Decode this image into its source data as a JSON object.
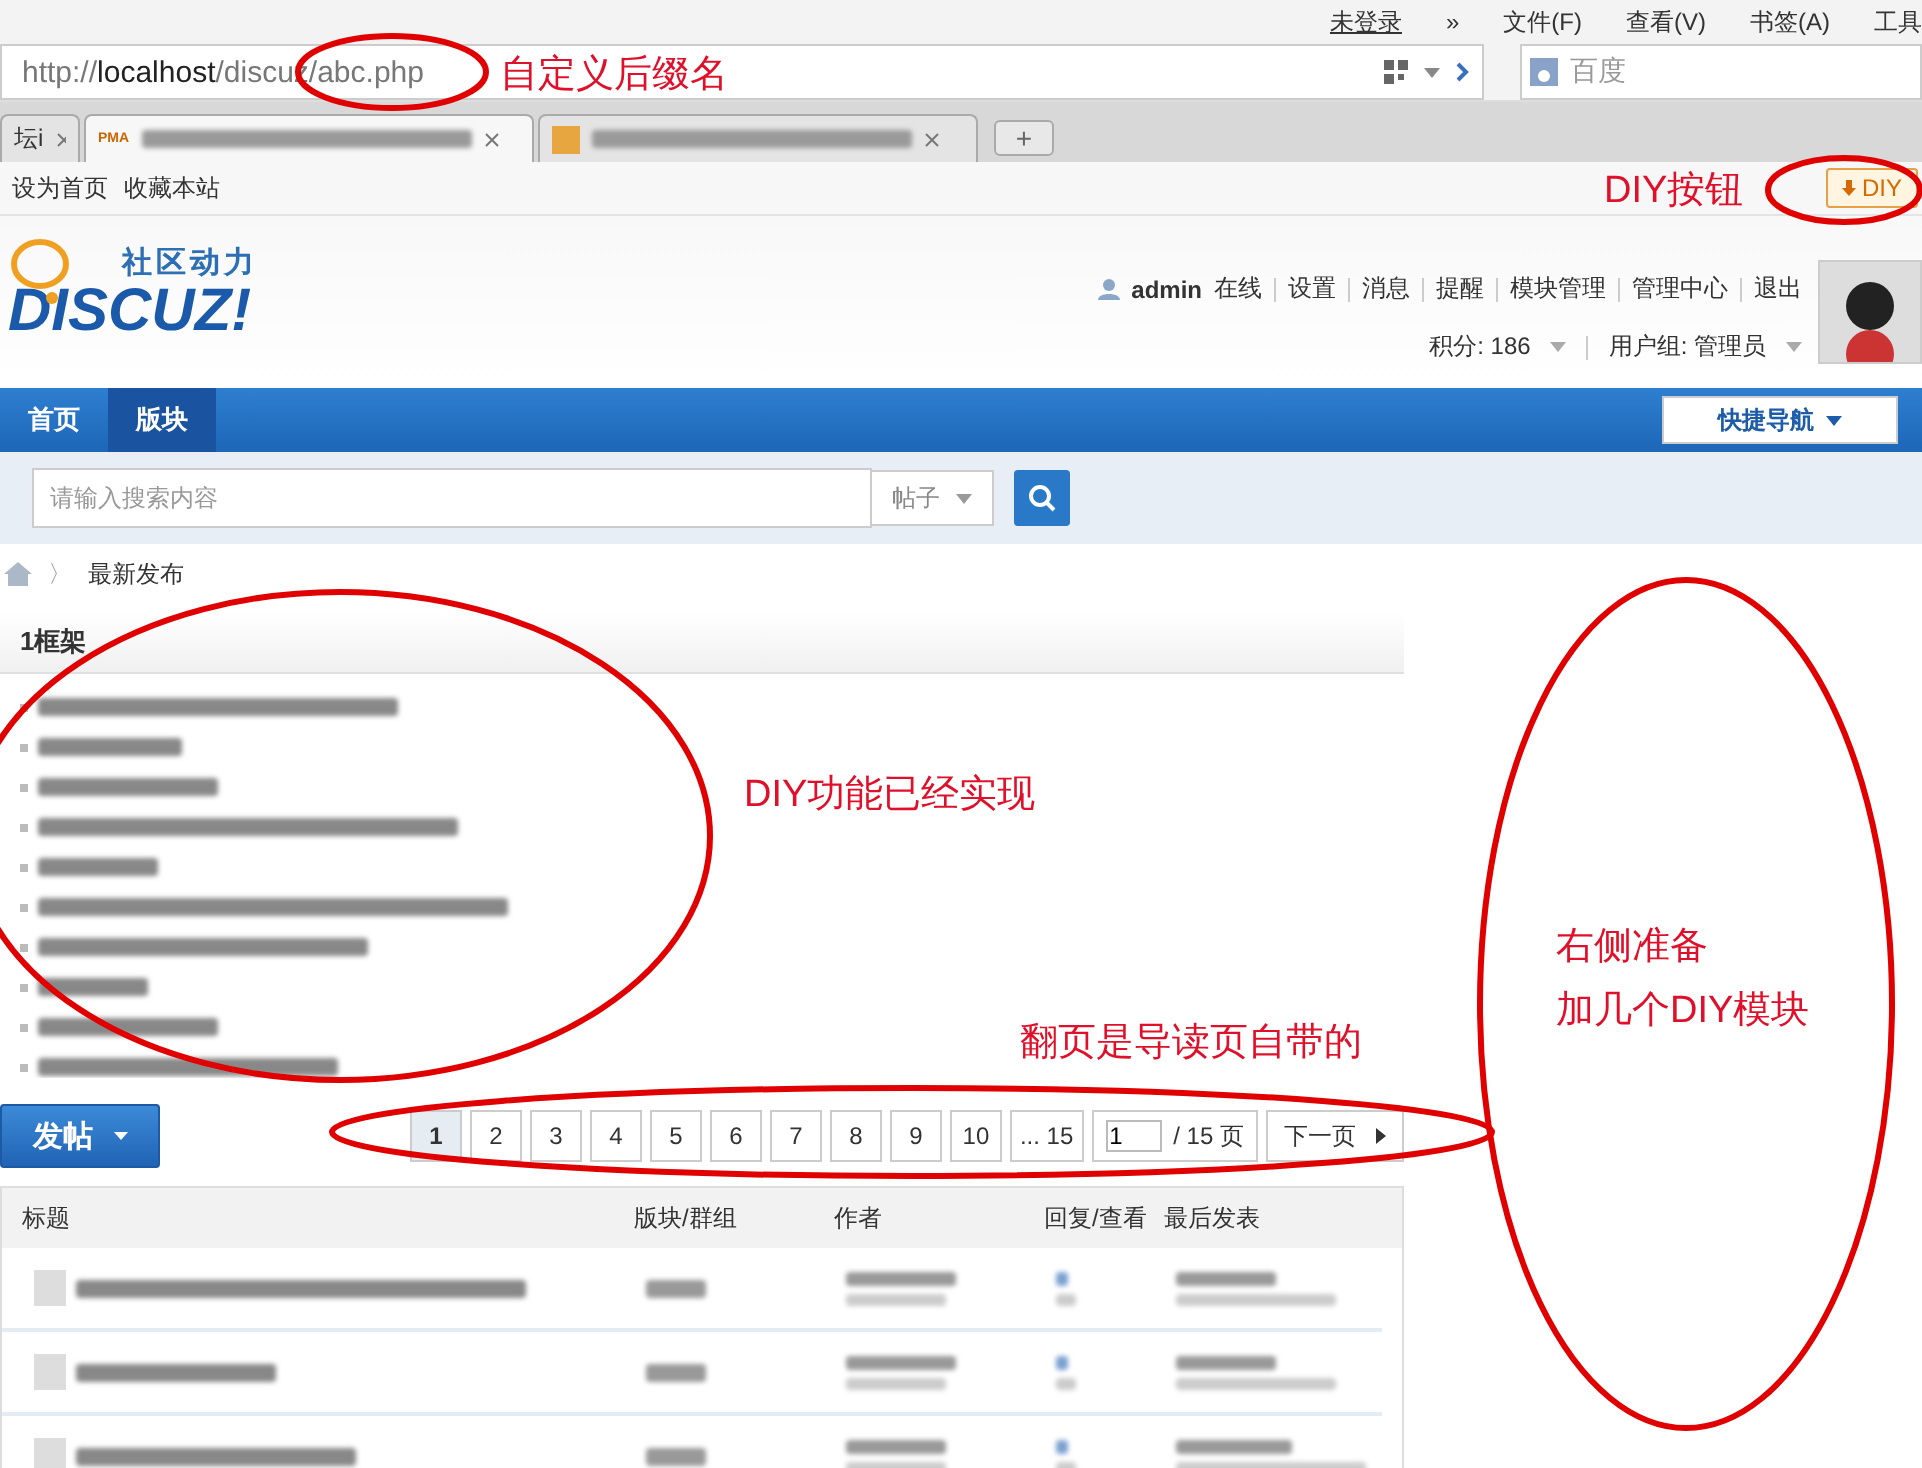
{
  "menu_bar": {
    "login": "未登录",
    "chevron": "»",
    "menus": [
      "文件(F)",
      "查看(V)",
      "书签(A)",
      "工具"
    ]
  },
  "address_bar": {
    "url": {
      "scheme": "http://",
      "host": "localhost",
      "path": "/discuz/abc.php"
    },
    "search": {
      "placeholder": "百度"
    }
  },
  "browser_tabs": [
    {
      "kind": "cut",
      "label": "坛i",
      "selected": false
    },
    {
      "kind": "blurred",
      "icon_text": "PMA",
      "selected": true
    },
    {
      "kind": "blurred",
      "selected": false
    }
  ],
  "new_tab": "+",
  "bookmarks": [
    "设为首页",
    "收藏本站"
  ],
  "diy_button": {
    "label": "DIY"
  },
  "header": {
    "logo": {
      "tagline": "社区动力",
      "wordmark": "DISCUZ!"
    },
    "user": {
      "name": "admin",
      "status": "在线",
      "links": [
        "设置",
        "消息",
        "提醒",
        "模块管理",
        "管理中心",
        "退出"
      ],
      "credits": "积分: 186",
      "group": "用户组: 管理员"
    }
  },
  "nav": {
    "items": [
      {
        "label": "首页",
        "selected": false
      },
      {
        "label": "版块",
        "selected": true
      }
    ],
    "quick_nav": "快捷导航"
  },
  "search": {
    "placeholder": "请输入搜索内容",
    "type": "帖子"
  },
  "breadcrumb": {
    "separator": "〉",
    "current": "最新发布"
  },
  "frame": {
    "title": "1框架",
    "items": [
      {
        "kind": "blurred"
      },
      {
        "kind": "blurred"
      },
      {
        "kind": "blurred"
      },
      {
        "kind": "blurred"
      },
      {
        "kind": "blurred"
      },
      {
        "kind": "blurred"
      },
      {
        "kind": "blurred"
      },
      {
        "kind": "blurred"
      },
      {
        "kind": "blurred"
      },
      {
        "kind": "blurred"
      }
    ]
  },
  "pager": {
    "post_button": "发帖",
    "pages": [
      {
        "label": "1",
        "selected": true
      },
      {
        "label": "2",
        "selected": false
      },
      {
        "label": "3",
        "selected": false
      },
      {
        "label": "4",
        "selected": false
      },
      {
        "label": "5",
        "selected": false
      },
      {
        "label": "6",
        "selected": false
      },
      {
        "label": "7",
        "selected": false
      },
      {
        "label": "8",
        "selected": false
      },
      {
        "label": "9",
        "selected": false
      },
      {
        "label": "10",
        "selected": false
      },
      {
        "label": "... 15",
        "selected": false
      }
    ],
    "page_input": "1",
    "total": "/ 15 页",
    "next": "下一页"
  },
  "table": {
    "columns": [
      "标题",
      "版块/群组",
      "作者",
      "回复/查看",
      "最后发表"
    ],
    "rows": [
      {
        "kind": "blurred"
      },
      {
        "kind": "blurred"
      },
      {
        "kind": "blurred"
      }
    ]
  },
  "annotations": [
    {
      "lines": [
        "自定义后缀名"
      ]
    },
    {
      "lines": [
        "DIY按钮"
      ]
    },
    {
      "lines": [
        "DIY功能已经实现"
      ]
    },
    {
      "lines": [
        "翻页是导读页自带的"
      ]
    },
    {
      "lines": [
        "右侧准备",
        "加几个DIY模块"
      ]
    }
  ]
}
